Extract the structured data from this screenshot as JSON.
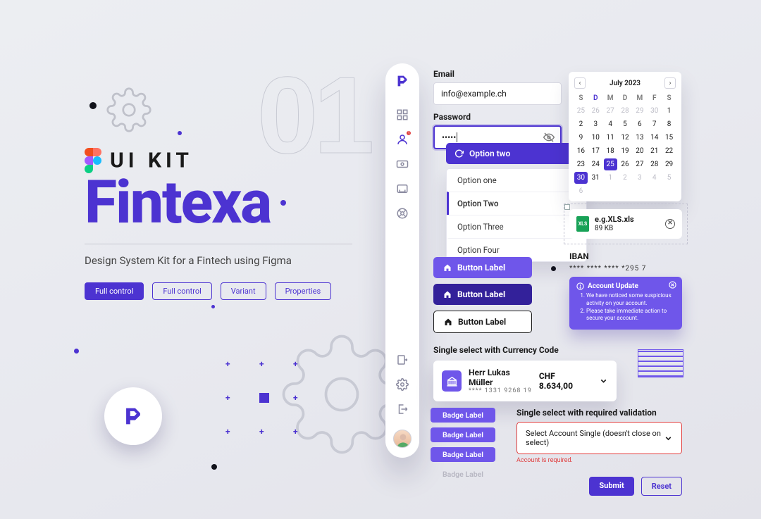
{
  "decor": {
    "big_number": "01"
  },
  "hero": {
    "tagline": "UI KIT",
    "brand": "Fintexa",
    "subtitle": "Design System Kit for a Fintech using Figma",
    "chips": [
      "Full control",
      "Full control",
      "Variant",
      "Properties"
    ]
  },
  "vnav": {
    "items": [
      {
        "name": "dashboard-icon"
      },
      {
        "name": "person-icon",
        "active": true,
        "badge": "1"
      },
      {
        "name": "payments-icon"
      },
      {
        "name": "inbox-icon"
      },
      {
        "name": "help-icon"
      }
    ],
    "footer_items": [
      {
        "name": "export-icon"
      },
      {
        "name": "settings-icon"
      },
      {
        "name": "logout-icon"
      }
    ]
  },
  "form": {
    "email": {
      "label": "Email",
      "value": "info@example.ch"
    },
    "password": {
      "label": "Password",
      "value": "•••••"
    }
  },
  "dropdown": {
    "selected": "Option two",
    "options": [
      "Option one",
      "Option Two",
      "Option Three",
      "Option Four"
    ]
  },
  "calendar": {
    "title": "July 2023",
    "dow": [
      "S",
      "D",
      "M",
      "D",
      "M",
      "F",
      "S"
    ],
    "dow_accent_index": 1,
    "leading_muted": [
      25,
      26,
      27,
      28,
      29,
      30
    ],
    "days_in_month": 31,
    "trailing_muted": [
      1,
      2,
      3,
      4,
      5,
      6
    ],
    "selected": [
      25,
      30
    ]
  },
  "file": {
    "name": "e.g.XLS.xls",
    "size": "89 KB"
  },
  "buttons": {
    "a": "Button Label",
    "b": "Button Label",
    "c": "Button Label"
  },
  "iban": {
    "label": "IBAN",
    "value": "**** **** **** *295 7"
  },
  "alert": {
    "title": "Account Update",
    "items": [
      "We have noticed some suspicious activity on your account.",
      "Please take immediate action to secure your account."
    ]
  },
  "currency": {
    "section_label": "Single select with Currency Code",
    "name": "Herr Lukas Müller",
    "acct": "**** 1331 9268 19",
    "amount": "CHF 8.634,00"
  },
  "badges": [
    "Badge Label",
    "Badge Label",
    "Badge Label",
    "Badge Label"
  ],
  "select_err": {
    "section_label": "Single select with required validation",
    "placeholder": "Select Account Single (doesn't close on select)",
    "error": "Account is required."
  },
  "actions": {
    "submit": "Submit",
    "reset": "Reset"
  }
}
